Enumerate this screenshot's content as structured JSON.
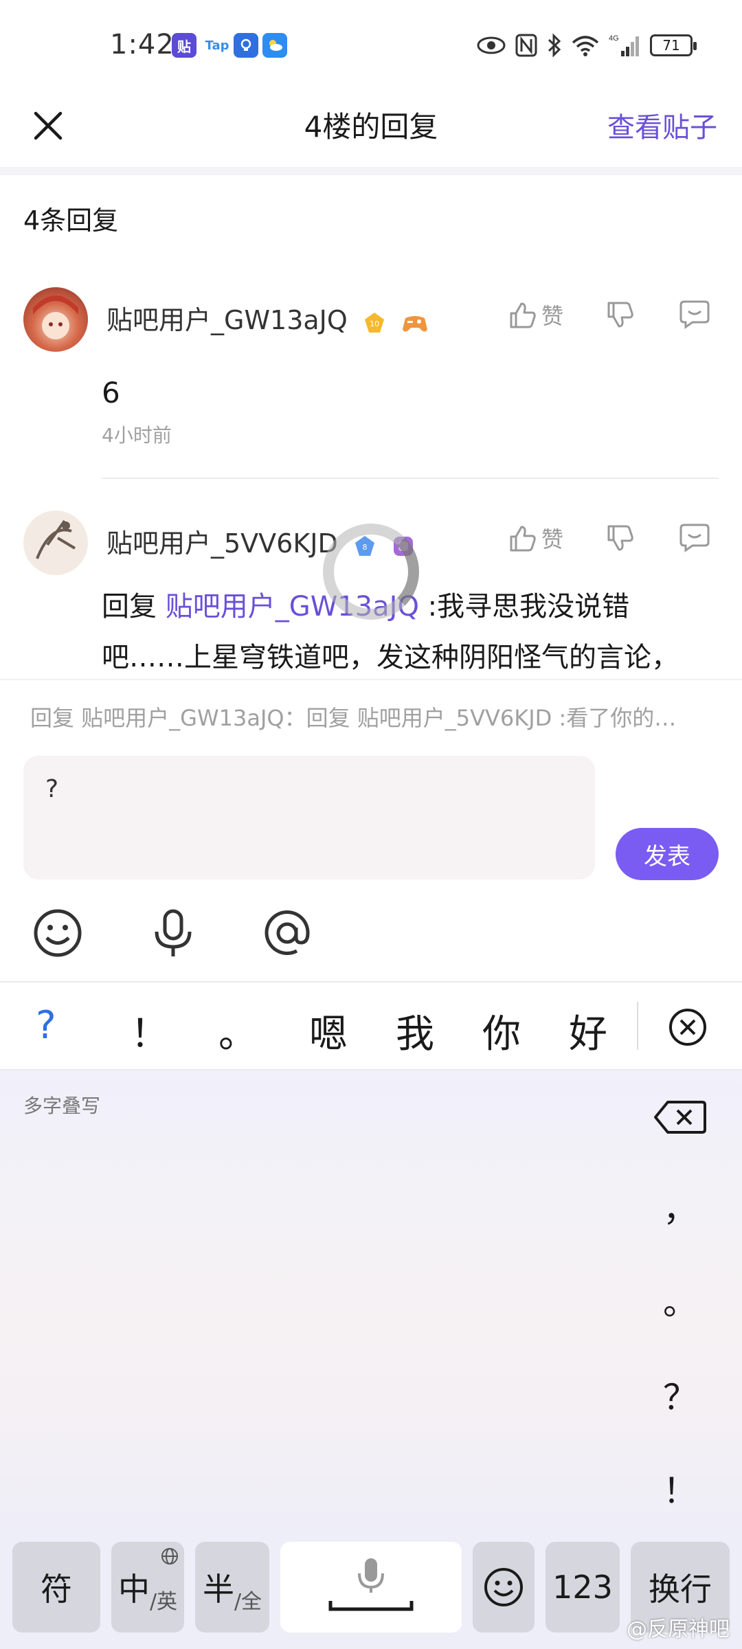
{
  "status_bar": {
    "time": "1:42",
    "app_icons": [
      "tieba-icon",
      "tap-icon",
      "bulb-icon",
      "weather-icon"
    ],
    "battery": "71",
    "network": "4G"
  },
  "header": {
    "title": "4楼的回复",
    "view_post": "查看贴子"
  },
  "reply_count": "4条回复",
  "comments": [
    {
      "username": "贴吧用户_GW13aJQ",
      "level": "10",
      "body": "6",
      "time": "4小时前",
      "like_label": "赞"
    },
    {
      "username": "贴吧用户_5VV6KJD",
      "level": "8",
      "body_prefix": "回复 ",
      "mention": "贴吧用户_GW13aJQ",
      "body_suffix": " :我寻思我没说错",
      "body_line2": "吧……上星穹铁道吧，发这种阴阳怪气的言论，",
      "like_label": "赞"
    }
  ],
  "composer": {
    "reply_hint": "回复 贴吧用户_GW13aJQ：回复 贴吧用户_5VV6KJD :看了你的…",
    "input_value": "?",
    "send_label": "发表"
  },
  "keyboard": {
    "candidates": [
      "?",
      "！",
      "。",
      "嗯",
      "我",
      "你",
      "好"
    ],
    "hw_label": "多字叠写",
    "hw_punct": [
      "，",
      "。",
      "？",
      "！"
    ],
    "keys": {
      "symbols": "符",
      "zh": "中",
      "zh_sub": "/英",
      "half": "半",
      "half_sub": "/全",
      "num": "123",
      "enter": "换行"
    }
  },
  "watermark": "@反原神吧",
  "colors": {
    "accent": "#6a50d8",
    "send": "#7a5cf2"
  }
}
